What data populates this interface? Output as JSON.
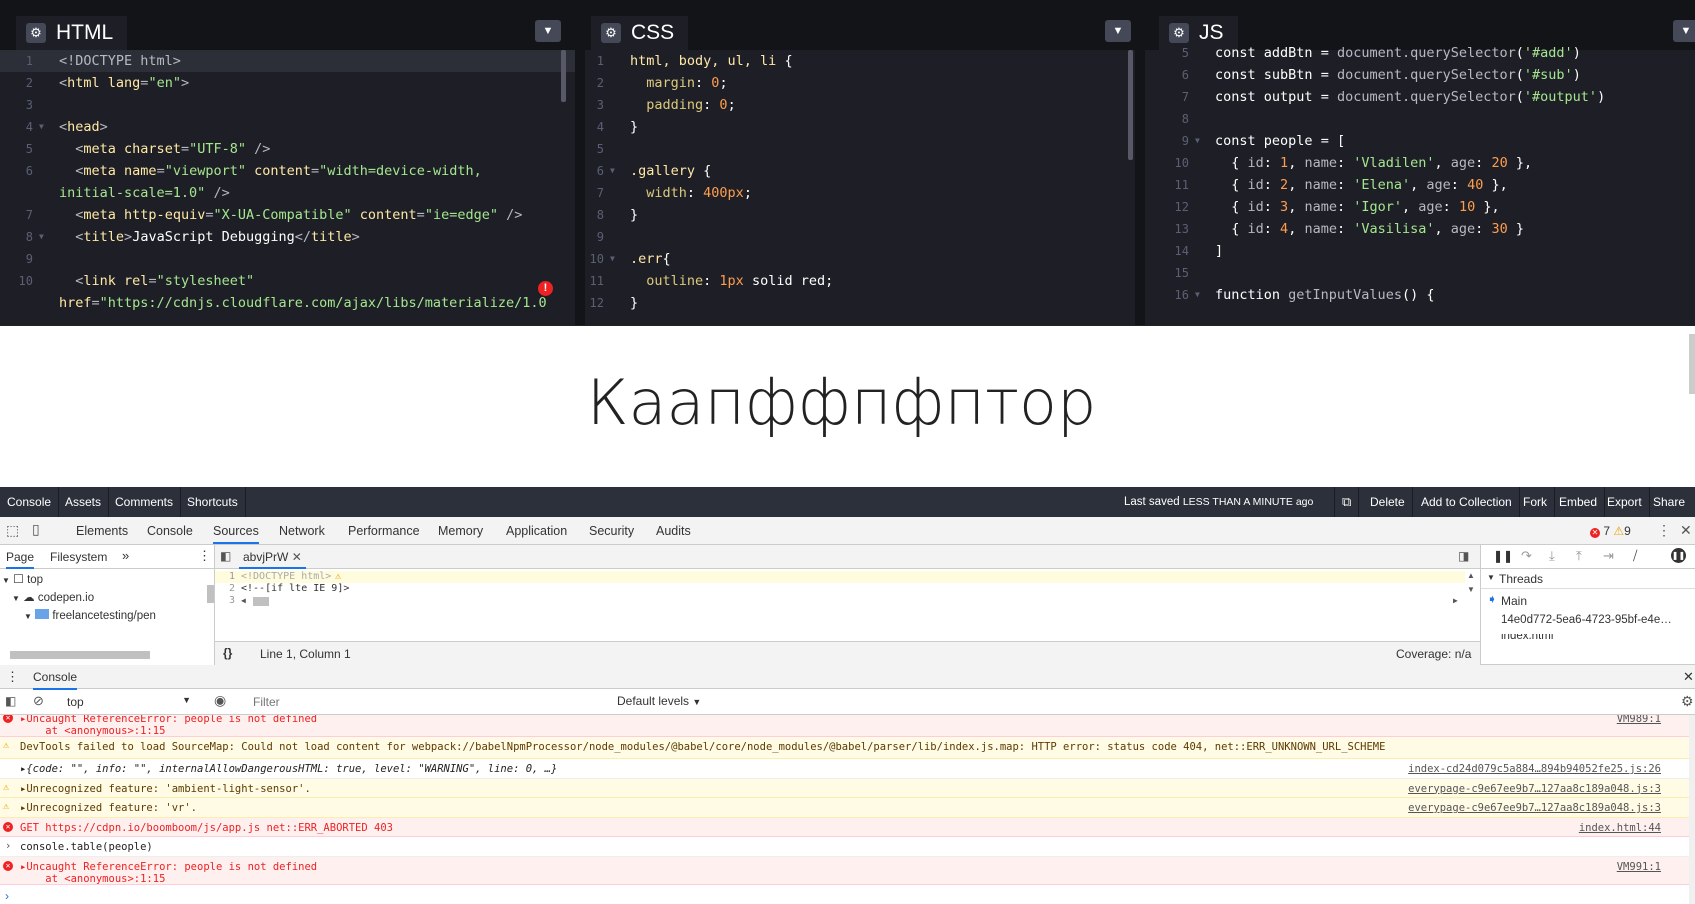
{
  "editors": {
    "html": {
      "title": "HTML",
      "lines": [
        {
          "n": "1",
          "fold": false,
          "parts": [
            [
              "t-tag",
              "<!DOCTYPE html>"
            ]
          ]
        },
        {
          "n": "2",
          "fold": false,
          "parts": [
            [
              "t-tag",
              "<"
            ],
            [
              "t-name",
              "html"
            ],
            [
              "t-attr",
              " lang"
            ],
            [
              "t-tag",
              "="
            ],
            [
              "t-str",
              "\"en\""
            ],
            [
              "t-tag",
              ">"
            ]
          ]
        },
        {
          "n": "3",
          "fold": false,
          "parts": []
        },
        {
          "n": "4",
          "fold": true,
          "parts": [
            [
              "t-tag",
              "<"
            ],
            [
              "t-name",
              "head"
            ],
            [
              "t-tag",
              ">"
            ]
          ]
        },
        {
          "n": "5",
          "fold": false,
          "parts": [
            [
              "t-kw",
              "  "
            ],
            [
              "t-tag",
              "<"
            ],
            [
              "t-name",
              "meta"
            ],
            [
              "t-attr",
              " charset"
            ],
            [
              "t-tag",
              "="
            ],
            [
              "t-str",
              "\"UTF-8\""
            ],
            [
              "t-tag",
              " />"
            ]
          ]
        },
        {
          "n": "6",
          "fold": false,
          "parts": [
            [
              "t-kw",
              "  "
            ],
            [
              "t-tag",
              "<"
            ],
            [
              "t-name",
              "meta"
            ],
            [
              "t-attr",
              " name"
            ],
            [
              "t-tag",
              "="
            ],
            [
              "t-str",
              "\"viewport\""
            ],
            [
              "t-attr",
              " content"
            ],
            [
              "t-tag",
              "="
            ],
            [
              "t-str",
              "\"width=device-width,"
            ]
          ]
        },
        {
          "n": "",
          "fold": false,
          "parts": [
            [
              "t-str",
              "initial-scale=1.0\""
            ],
            [
              "t-tag",
              " />"
            ]
          ]
        },
        {
          "n": "7",
          "fold": false,
          "parts": [
            [
              "t-kw",
              "  "
            ],
            [
              "t-tag",
              "<"
            ],
            [
              "t-name",
              "meta"
            ],
            [
              "t-attr",
              " http-equiv"
            ],
            [
              "t-tag",
              "="
            ],
            [
              "t-str",
              "\"X-UA-Compatible\""
            ],
            [
              "t-attr",
              " content"
            ],
            [
              "t-tag",
              "="
            ],
            [
              "t-str",
              "\"ie=edge\""
            ],
            [
              "t-tag",
              " />"
            ]
          ]
        },
        {
          "n": "8",
          "fold": true,
          "parts": [
            [
              "t-kw",
              "  "
            ],
            [
              "t-tag",
              "<"
            ],
            [
              "t-name",
              "title"
            ],
            [
              "t-tag",
              ">"
            ],
            [
              "t-kw",
              "JavaScript Debugging"
            ],
            [
              "t-tag",
              "</"
            ],
            [
              "t-name",
              "title"
            ],
            [
              "t-tag",
              ">"
            ]
          ]
        },
        {
          "n": "9",
          "fold": false,
          "parts": []
        },
        {
          "n": "10",
          "fold": false,
          "parts": [
            [
              "t-kw",
              "  "
            ],
            [
              "t-tag",
              "<"
            ],
            [
              "t-name",
              "link"
            ],
            [
              "t-attr",
              " rel"
            ],
            [
              "t-tag",
              "="
            ],
            [
              "t-str",
              "\"stylesheet\""
            ]
          ]
        },
        {
          "n": "",
          "fold": false,
          "parts": [
            [
              "t-attr",
              "href"
            ],
            [
              "t-tag",
              "="
            ],
            [
              "t-str",
              "\"https://cdnjs.cloudflare.com/ajax/libs/materialize/1.0"
            ]
          ]
        }
      ]
    },
    "css": {
      "title": "CSS",
      "lines": [
        {
          "n": "1",
          "fold": false,
          "parts": [
            [
              "t-sel",
              "html, body, ul, li"
            ],
            [
              "t-kw",
              " {"
            ]
          ]
        },
        {
          "n": "2",
          "fold": false,
          "parts": [
            [
              "t-prop",
              "  margin"
            ],
            [
              "t-kw",
              ": "
            ],
            [
              "t-num",
              "0"
            ],
            [
              "t-kw",
              ";"
            ]
          ]
        },
        {
          "n": "3",
          "fold": false,
          "parts": [
            [
              "t-prop",
              "  padding"
            ],
            [
              "t-kw",
              ": "
            ],
            [
              "t-num",
              "0"
            ],
            [
              "t-kw",
              ";"
            ]
          ]
        },
        {
          "n": "4",
          "fold": false,
          "parts": [
            [
              "t-kw",
              "}"
            ]
          ]
        },
        {
          "n": "5",
          "fold": false,
          "parts": []
        },
        {
          "n": "6",
          "fold": true,
          "parts": [
            [
              "t-sel",
              ".gallery"
            ],
            [
              "t-kw",
              " {"
            ]
          ]
        },
        {
          "n": "7",
          "fold": false,
          "parts": [
            [
              "t-prop",
              "  width"
            ],
            [
              "t-kw",
              ": "
            ],
            [
              "t-num",
              "400px"
            ],
            [
              "t-kw",
              ";"
            ]
          ]
        },
        {
          "n": "8",
          "fold": false,
          "parts": [
            [
              "t-kw",
              "}"
            ]
          ]
        },
        {
          "n": "9",
          "fold": false,
          "parts": []
        },
        {
          "n": "10",
          "fold": true,
          "parts": [
            [
              "t-sel",
              ".err"
            ],
            [
              "t-kw",
              "{"
            ]
          ]
        },
        {
          "n": "11",
          "fold": false,
          "parts": [
            [
              "t-prop",
              "  outline"
            ],
            [
              "t-kw",
              ": "
            ],
            [
              "t-num",
              "1px"
            ],
            [
              "t-kw",
              " solid red;"
            ]
          ]
        },
        {
          "n": "12",
          "fold": false,
          "parts": [
            [
              "t-kw",
              "}"
            ]
          ]
        }
      ]
    },
    "js": {
      "title": "JS",
      "lines": [
        {
          "n": "5",
          "fold": false,
          "parts": [
            [
              "t-kw",
              "const "
            ],
            [
              "t-var",
              "addBtn"
            ],
            [
              "t-kw",
              " = "
            ],
            [
              "t-key",
              "document.querySelector"
            ],
            [
              "t-kw",
              "("
            ],
            [
              "t-jstr",
              "'#add'"
            ],
            [
              "t-kw",
              ")"
            ]
          ]
        },
        {
          "n": "6",
          "fold": false,
          "parts": [
            [
              "t-kw",
              "const "
            ],
            [
              "t-var",
              "subBtn"
            ],
            [
              "t-kw",
              " = "
            ],
            [
              "t-key",
              "document.querySelector"
            ],
            [
              "t-kw",
              "("
            ],
            [
              "t-jstr",
              "'#sub'"
            ],
            [
              "t-kw",
              ")"
            ]
          ]
        },
        {
          "n": "7",
          "fold": false,
          "parts": [
            [
              "t-kw",
              "const "
            ],
            [
              "t-var",
              "output"
            ],
            [
              "t-kw",
              " = "
            ],
            [
              "t-key",
              "document.querySelector"
            ],
            [
              "t-kw",
              "("
            ],
            [
              "t-jstr",
              "'#output'"
            ],
            [
              "t-kw",
              ")"
            ]
          ]
        },
        {
          "n": "8",
          "fold": false,
          "parts": []
        },
        {
          "n": "9",
          "fold": true,
          "parts": [
            [
              "t-kw",
              "const "
            ],
            [
              "t-var",
              "people"
            ],
            [
              "t-kw",
              " = ["
            ]
          ]
        },
        {
          "n": "10",
          "fold": false,
          "parts": [
            [
              "t-kw",
              "  { "
            ],
            [
              "t-key",
              "id"
            ],
            [
              "t-kw",
              ": "
            ],
            [
              "t-num",
              "1"
            ],
            [
              "t-kw",
              ", "
            ],
            [
              "t-key",
              "name"
            ],
            [
              "t-kw",
              ": "
            ],
            [
              "t-jstr",
              "'Vladilen'"
            ],
            [
              "t-kw",
              ", "
            ],
            [
              "t-key",
              "age"
            ],
            [
              "t-kw",
              ": "
            ],
            [
              "t-num",
              "20"
            ],
            [
              "t-kw",
              " },"
            ]
          ]
        },
        {
          "n": "11",
          "fold": false,
          "parts": [
            [
              "t-kw",
              "  { "
            ],
            [
              "t-key",
              "id"
            ],
            [
              "t-kw",
              ": "
            ],
            [
              "t-num",
              "2"
            ],
            [
              "t-kw",
              ", "
            ],
            [
              "t-key",
              "name"
            ],
            [
              "t-kw",
              ": "
            ],
            [
              "t-jstr",
              "'Elena'"
            ],
            [
              "t-kw",
              ", "
            ],
            [
              "t-key",
              "age"
            ],
            [
              "t-kw",
              ": "
            ],
            [
              "t-num",
              "40"
            ],
            [
              "t-kw",
              " },"
            ]
          ]
        },
        {
          "n": "12",
          "fold": false,
          "parts": [
            [
              "t-kw",
              "  { "
            ],
            [
              "t-key",
              "id"
            ],
            [
              "t-kw",
              ": "
            ],
            [
              "t-num",
              "3"
            ],
            [
              "t-kw",
              ", "
            ],
            [
              "t-key",
              "name"
            ],
            [
              "t-kw",
              ": "
            ],
            [
              "t-jstr",
              "'Igor'"
            ],
            [
              "t-kw",
              ", "
            ],
            [
              "t-key",
              "age"
            ],
            [
              "t-kw",
              ": "
            ],
            [
              "t-num",
              "10"
            ],
            [
              "t-kw",
              " },"
            ]
          ]
        },
        {
          "n": "13",
          "fold": false,
          "parts": [
            [
              "t-kw",
              "  { "
            ],
            [
              "t-key",
              "id"
            ],
            [
              "t-kw",
              ": "
            ],
            [
              "t-num",
              "4"
            ],
            [
              "t-kw",
              ", "
            ],
            [
              "t-key",
              "name"
            ],
            [
              "t-kw",
              ": "
            ],
            [
              "t-jstr",
              "'Vasilisa'"
            ],
            [
              "t-kw",
              ", "
            ],
            [
              "t-key",
              "age"
            ],
            [
              "t-kw",
              ": "
            ],
            [
              "t-num",
              "30"
            ],
            [
              "t-kw",
              " }"
            ]
          ]
        },
        {
          "n": "14",
          "fold": false,
          "parts": [
            [
              "t-kw",
              "]"
            ]
          ]
        },
        {
          "n": "15",
          "fold": false,
          "parts": []
        },
        {
          "n": "16",
          "fold": true,
          "parts": [
            [
              "t-kw",
              "function "
            ],
            [
              "t-key",
              "getInputValues"
            ],
            [
              "t-kw",
              "() {"
            ]
          ]
        }
      ]
    }
  },
  "preview": {
    "title": "Каапффпфптор"
  },
  "pen_bar": {
    "left": [
      "Console",
      "Assets",
      "Comments",
      "Shortcuts"
    ],
    "last_saved_label": "Last saved",
    "last_saved_value": "LESS THAN A MINUTE ago",
    "right": [
      "Delete",
      "Add to Collection",
      "Fork",
      "Embed",
      "Export",
      "Share"
    ]
  },
  "devtools": {
    "tabs": [
      "Elements",
      "Console",
      "Sources",
      "Network",
      "Performance",
      "Memory",
      "Application",
      "Security",
      "Audits"
    ],
    "active_tab": "Sources",
    "error_count": "7",
    "warning_count": "9",
    "navigator": {
      "tabs": [
        "Page",
        "Filesystem"
      ],
      "tree": [
        "top",
        "codepen.io",
        "freelancetesting/pen"
      ]
    },
    "file_tab": "abvjPrW",
    "source_lines": [
      {
        "n": "1",
        "text": "<!DOCTYPE html>"
      },
      {
        "n": "2",
        "text": "<!--[if lte IE 9]>"
      },
      {
        "n": "3",
        "text": ""
      }
    ],
    "cursor_status": "Line 1, Column 1",
    "coverage": "Coverage: n/a",
    "threads": {
      "title": "Threads",
      "items": [
        "Main",
        "14e0d772-5ea6-4723-95bf-e4e…",
        "index.html"
      ]
    },
    "drawer_tab": "Console",
    "context": "top",
    "filter_placeholder": "Filter",
    "levels": "Default levels",
    "messages": [
      {
        "type": "err",
        "text": "▸Uncaught ReferenceError: people is not defined",
        "text2": "    at <anonymous>:1:15",
        "src": "VM989:1"
      },
      {
        "type": "warn",
        "text": "DevTools failed to load SourceMap: Could not load content for webpack://babelNpmProcessor/node_modules/@babel/core/node_modules/@babel/parser/lib/index.js.map: HTTP error: status code 404, net::ERR_UNKNOWN_URL_SCHEME",
        "text2": "",
        "src": ""
      },
      {
        "type": "log",
        "text": "▸{code: \"\", info: \"\", internalAllowDangerousHTML: true, level: \"WARNING\", line: 0, …}",
        "text2": "",
        "src": "index-cd24d079c5a884…894b94052fe25.js:26"
      },
      {
        "type": "warn",
        "text": "▸Unrecognized feature: 'ambient-light-sensor'.",
        "text2": "",
        "src": "everypage-c9e67ee9b7…127aa8c189a048.js:3"
      },
      {
        "type": "warn",
        "text": "▸Unrecognized feature: 'vr'.",
        "text2": "",
        "src": "everypage-c9e67ee9b7…127aa8c189a048.js:3"
      },
      {
        "type": "err",
        "text": "GET https://cdpn.io/boomboom/js/app.js net::ERR_ABORTED 403",
        "text2": "",
        "src": "index.html:44"
      },
      {
        "type": "input",
        "text": "console.table(people)",
        "text2": "",
        "src": ""
      },
      {
        "type": "err",
        "text": "▸Uncaught ReferenceError: people is not defined",
        "text2": "    at <anonymous>:1:15",
        "src": "VM991:1"
      }
    ]
  }
}
